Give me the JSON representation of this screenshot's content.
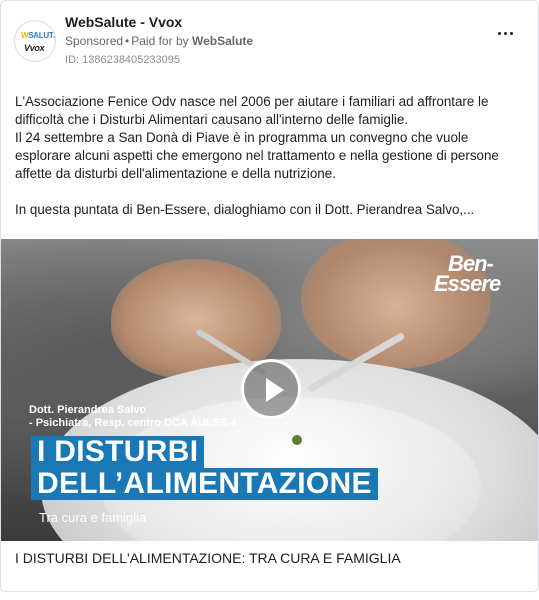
{
  "post": {
    "page_name": "WebSalute - Vvox",
    "avatar_line1a": "W",
    "avatar_line1b": "SALUTE",
    "avatar_line2": "Vvox",
    "sponsored": "Sponsored",
    "paid_for_by": "Paid for by",
    "advertiser": "WebSalute",
    "ad_id": "ID: 1386238405233095",
    "more_icon": "more-horizontal-icon",
    "text_lines": [
      "L'Associazione Fenice Odv nasce nel 2006 per aiutare i familiari ad affrontare le",
      "difficoltà che i Disturbi Alimentari causano all'interno delle famiglie.",
      "Il 24 settembre a San Donà di Piave è in programma un convegno che vuole",
      "esplorare alcuni aspetti che emergono nel trattamento e nella gestione di persone",
      "affette da disturbi dell'alimentazione e della nutrizione."
    ],
    "text_last_line": "In questa puntata di Ben-Essere, dialoghiamo con il Dott. Pierandrea Salvo,..."
  },
  "media": {
    "logo_top": "Ben-",
    "logo_bottom": "Essere",
    "speaker_line1": "Dott. Pierandrea Salvo",
    "speaker_line2": "- Psichiatra, Resp. centro DCA AULSS 4",
    "headline_line1": "I DISTURBI",
    "headline_line2": "DELL’ALIMENTAZIONE",
    "subtitle": "Tra cura e famiglia",
    "play_icon": "play-icon",
    "accent_color": "#1a78b5"
  },
  "caption": "I DISTURBI DELL'ALIMENTAZIONE: TRA CURA E FAMIGLIA"
}
